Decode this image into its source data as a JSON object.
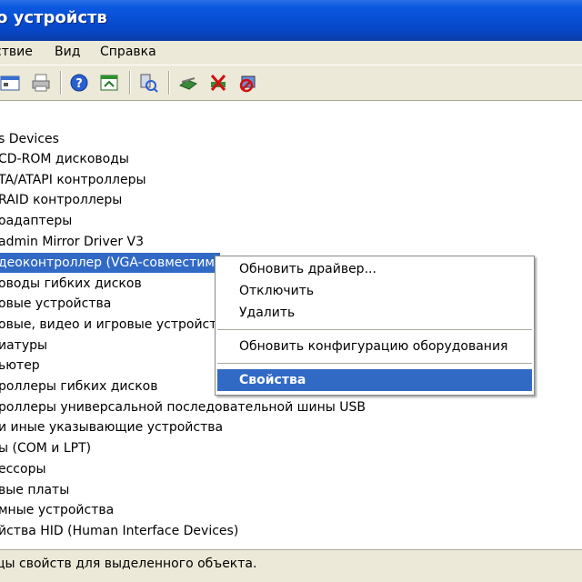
{
  "window": {
    "title": "о устройств"
  },
  "menubar": {
    "items": [
      "ствие",
      "Вид",
      "Справка"
    ]
  },
  "toolbar": {
    "icons": [
      "properties-icon",
      "print-icon",
      "help-icon",
      "view-icon",
      "scan-hardware-icon",
      "update-driver-icon",
      "uninstall-icon",
      "disable-icon"
    ]
  },
  "tree": {
    "items": [
      "s Devices",
      "CD-ROM дисководы",
      "TA/ATAPI контроллеры",
      "RAID контроллеры",
      "оадаптеры",
      "admin Mirror Driver V3",
      "деоконтроллер (VGA-совместим",
      "оводы гибких дисков",
      "овые устройства",
      "овые, видео и игровые устройст",
      "иатуры",
      "ьютер",
      "роллеры гибких дисков",
      "роллеры универсальной последовательной шины USB",
      "и иные указывающие устройства",
      "ы (COM и LPT)",
      "ессоры",
      "вые платы",
      "мные устройства",
      "йства HID (Human Interface Devices)"
    ],
    "selected_index": 6
  },
  "context_menu": {
    "items": [
      "Обновить драйвер...",
      "Отключить",
      "Удалить",
      "Обновить конфигурацию оборудования",
      "Свойства"
    ],
    "highlighted_index": 4
  },
  "statusbar": {
    "text": "цы свойств для выделенного объекта."
  },
  "colors": {
    "title_blue": "#0a58e0",
    "selection": "#316ac5",
    "chrome": "#ece9d8"
  }
}
